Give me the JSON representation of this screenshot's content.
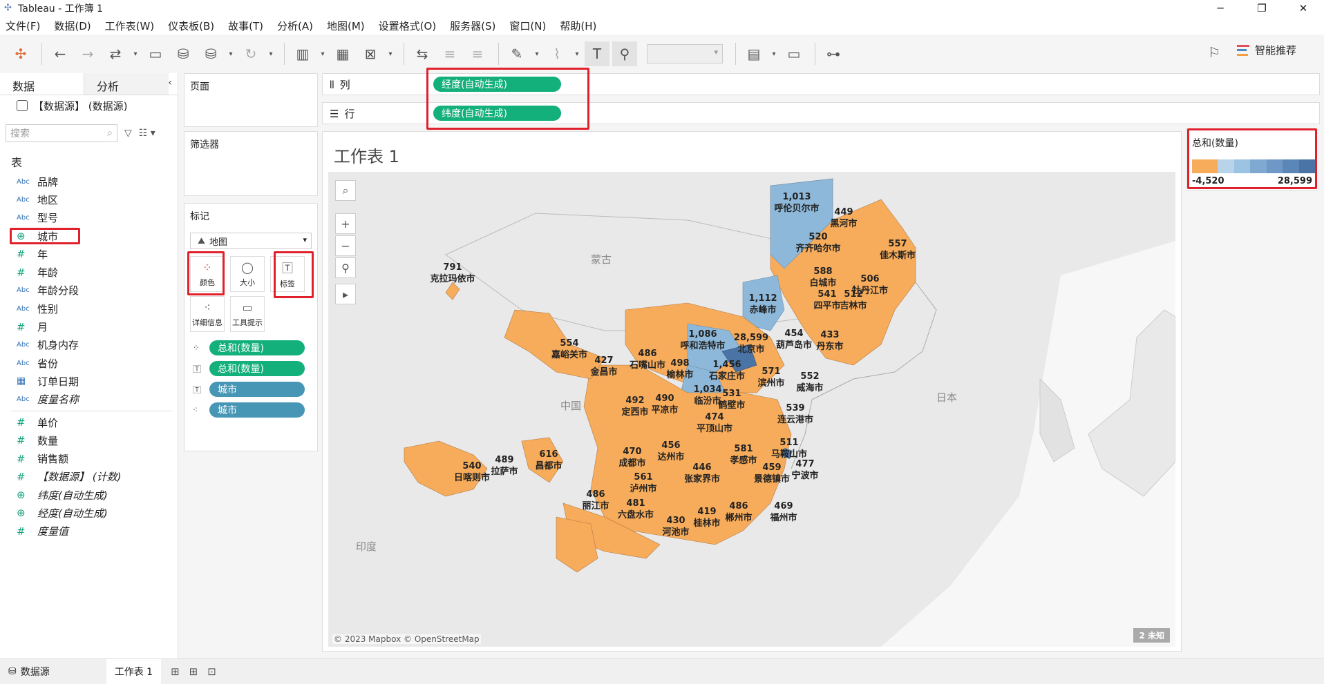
{
  "window": {
    "title": "Tableau - 工作簿 1",
    "controls": [
      "─",
      "❐",
      "✕"
    ]
  },
  "menu": [
    "文件(F)",
    "数据(D)",
    "工作表(W)",
    "仪表板(B)",
    "故事(T)",
    "分析(A)",
    "地图(M)",
    "设置格式(O)",
    "服务器(S)",
    "窗口(N)",
    "帮助(H)"
  ],
  "toolbar": {
    "smart_recommend_label": "智能推荐"
  },
  "left_pane": {
    "tabs": [
      "数据",
      "分析"
    ],
    "datasource": "【数据源】 (数据源)",
    "search_placeholder": "搜索",
    "tables_heading": "表",
    "dimensions": [
      {
        "type": "Abc",
        "name": "品牌"
      },
      {
        "type": "Abc",
        "name": "地区"
      },
      {
        "type": "Abc",
        "name": "型号"
      },
      {
        "type": "geo",
        "name": "城市"
      },
      {
        "type": "#",
        "name": "年"
      },
      {
        "type": "#",
        "name": "年龄"
      },
      {
        "type": "Abc",
        "name": "年龄分段"
      },
      {
        "type": "Abc",
        "name": "性别"
      },
      {
        "type": "#",
        "name": "月"
      },
      {
        "type": "Abc",
        "name": "机身内存"
      },
      {
        "type": "Abc",
        "name": "省份"
      },
      {
        "type": "date",
        "name": "订单日期"
      },
      {
        "type": "Abc",
        "name": "度量名称",
        "italic": true
      }
    ],
    "measures": [
      {
        "type": "#",
        "name": "单价"
      },
      {
        "type": "#",
        "name": "数量"
      },
      {
        "type": "#",
        "name": "销售额"
      },
      {
        "type": "#",
        "name": "【数据源】 (计数)",
        "italic": true
      },
      {
        "type": "geo",
        "name": "纬度(自动生成)",
        "italic": true
      },
      {
        "type": "geo",
        "name": "经度(自动生成)",
        "italic": true
      },
      {
        "type": "#",
        "name": "度量值",
        "italic": true
      }
    ]
  },
  "cards": {
    "pages_title": "页面",
    "filters_title": "筛选器",
    "marks_title": "标记",
    "marks_type": "地图",
    "mark_buttons": [
      "颜色",
      "大小",
      "标签",
      "详细信息",
      "工具提示"
    ],
    "mark_pills": [
      {
        "icon": "color",
        "label": "总和(数量)",
        "kind": "green"
      },
      {
        "icon": "label",
        "label": "总和(数量)",
        "kind": "green"
      },
      {
        "icon": "label",
        "label": "城市",
        "kind": "blue"
      },
      {
        "icon": "detail",
        "label": "城市",
        "kind": "blue"
      }
    ]
  },
  "shelves": {
    "columns_label": "列",
    "columns_pill": "经度(自动生成)",
    "rows_label": "行",
    "rows_pill": "纬度(自动生成)"
  },
  "worksheet": {
    "title": "工作表 1",
    "country_labels": [
      "蒙古",
      "中国",
      "日本",
      "印度"
    ],
    "attribution": "© 2023 Mapbox © OpenStreetMap",
    "unknown_badge": "2 未知",
    "cities": [
      {
        "value": "1,013",
        "name": "呼伦贝尔市",
        "color": "#8db8d9"
      },
      {
        "value": "449",
        "name": "黑河市",
        "color": "#f7ac5b"
      },
      {
        "value": "520",
        "name": "齐齐哈尔市",
        "color": "#f7ac5b"
      },
      {
        "value": "557",
        "name": "佳木斯市",
        "color": "#f7ac5b"
      },
      {
        "value": "588",
        "name": "白城市",
        "color": "#f7ac5b"
      },
      {
        "value": "506",
        "name": "牡丹江市",
        "color": "#f7ac5b"
      },
      {
        "value": "541",
        "name": "四平市",
        "color": "#f7ac5b"
      },
      {
        "value": "512",
        "name": "吉林市",
        "color": "#f7ac5b"
      },
      {
        "value": "791",
        "name": "克拉玛依市",
        "color": "#f7ac5b"
      },
      {
        "value": "1,112",
        "name": "赤峰市",
        "color": "#8db8d9"
      },
      {
        "value": "1,086",
        "name": "呼和浩特市",
        "color": "#8db8d9"
      },
      {
        "value": "28,599",
        "name": "北京市",
        "color": "#4a74a5"
      },
      {
        "value": "454",
        "name": "葫芦岛市",
        "color": "#f7ac5b"
      },
      {
        "value": "433",
        "name": "丹东市",
        "color": "#f7ac5b"
      },
      {
        "value": "554",
        "name": "嘉峪关市",
        "color": "#f7ac5b"
      },
      {
        "value": "427",
        "name": "金昌市",
        "color": "#f7ac5b"
      },
      {
        "value": "486",
        "name": "石嘴山市",
        "color": "#f7ac5b"
      },
      {
        "value": "498",
        "name": "榆林市",
        "color": "#f7ac5b"
      },
      {
        "value": "1,456",
        "name": "石家庄市",
        "color": "#8db8d9"
      },
      {
        "value": "571",
        "name": "滨州市",
        "color": "#f7ac5b"
      },
      {
        "value": "552",
        "name": "威海市",
        "color": "#f7ac5b"
      },
      {
        "value": "1,034",
        "name": "临汾市",
        "color": "#8db8d9"
      },
      {
        "value": "531",
        "name": "鹤壁市",
        "color": "#f7ac5b"
      },
      {
        "value": "492",
        "name": "定西市",
        "color": "#f7ac5b"
      },
      {
        "value": "490",
        "name": "平凉市",
        "color": "#f7ac5b"
      },
      {
        "value": "474",
        "name": "平顶山市",
        "color": "#f7ac5b"
      },
      {
        "value": "539",
        "name": "连云港市",
        "color": "#f7ac5b"
      },
      {
        "value": "540",
        "name": "日喀则市",
        "color": "#f7ac5b"
      },
      {
        "value": "489",
        "name": "拉萨市",
        "color": "#f7ac5b"
      },
      {
        "value": "616",
        "name": "昌都市",
        "color": "#f7ac5b"
      },
      {
        "value": "470",
        "name": "成都市",
        "color": "#f7ac5b"
      },
      {
        "value": "456",
        "name": "达州市",
        "color": "#f7ac5b"
      },
      {
        "value": "581",
        "name": "孝感市",
        "color": "#f7ac5b"
      },
      {
        "value": "511",
        "name": "马鞍山市",
        "color": "#f7ac5b"
      },
      {
        "value": "477",
        "name": "宁波市",
        "color": "#f7ac5b"
      },
      {
        "value": "561",
        "name": "泸州市",
        "color": "#f7ac5b"
      },
      {
        "value": "446",
        "name": "张家界市",
        "color": "#f7ac5b"
      },
      {
        "value": "459",
        "name": "景德镇市",
        "color": "#f7ac5b"
      },
      {
        "value": "486",
        "name": "丽江市",
        "color": "#f7ac5b"
      },
      {
        "value": "481",
        "name": "六盘水市",
        "color": "#f7ac5b"
      },
      {
        "value": "419",
        "name": "桂林市",
        "color": "#f7ac5b"
      },
      {
        "value": "486",
        "name": "郴州市",
        "color": "#f7ac5b"
      },
      {
        "value": "469",
        "name": "福州市",
        "color": "#f7ac5b"
      },
      {
        "value": "430",
        "name": "河池市",
        "color": "#f7ac5b"
      }
    ]
  },
  "legend": {
    "title": "总和(数量)",
    "min": "-4,520",
    "max": "28,599",
    "colors": [
      "#f7ac5b",
      "#b9d4ea",
      "#9cc3e2",
      "#7fa9d1",
      "#6f98c6",
      "#5b87b8",
      "#4a74a5"
    ]
  },
  "bottom_tabs": {
    "datasource": "数据源",
    "sheet": "工作表 1"
  }
}
